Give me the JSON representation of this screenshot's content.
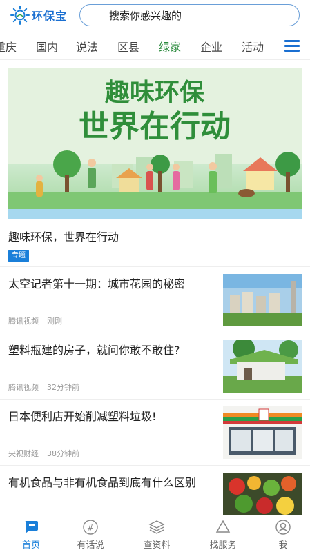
{
  "header": {
    "logo_text": "环保宝",
    "logo_icon": "sun-icon",
    "search_placeholder": "搜索你感兴趣的"
  },
  "tabs": [
    {
      "label": "重庆"
    },
    {
      "label": "国内"
    },
    {
      "label": "说法"
    },
    {
      "label": "区县"
    },
    {
      "label": "绿家",
      "active": true
    },
    {
      "label": "企业"
    },
    {
      "label": "活动"
    }
  ],
  "feature": {
    "banner_line1": "趣味环保",
    "banner_line2": "世界在行动",
    "title": "趣味环保，世界在行动",
    "badge": "专题"
  },
  "articles": [
    {
      "title": "太空记者第十一期：城市花园的秘密",
      "source": "腾讯视频",
      "time": "刚刚",
      "thumb": "city-buildings"
    },
    {
      "title": "塑料瓶建的房子，就问你敢不敢住?",
      "source": "腾讯视频",
      "time": "32分钟前",
      "thumb": "bottle-house"
    },
    {
      "title": "日本便利店开始削减塑料垃圾!",
      "source": "央视财经",
      "time": "38分钟前",
      "thumb": "convenience-store"
    },
    {
      "title": "有机食品与非有机食品到底有什么区别",
      "source": "",
      "time": "",
      "thumb": "vegetables"
    }
  ],
  "bottom_nav": [
    {
      "label": "首页",
      "icon": "home-chat-icon",
      "active": true
    },
    {
      "label": "有话说",
      "icon": "hashtag-icon"
    },
    {
      "label": "查资料",
      "icon": "layers-icon"
    },
    {
      "label": "找服务",
      "icon": "recycle-icon"
    },
    {
      "label": "我",
      "icon": "user-icon"
    }
  ],
  "colors": {
    "brand_blue": "#1a7fd9",
    "active_tab_green": "#2a8a3c"
  }
}
